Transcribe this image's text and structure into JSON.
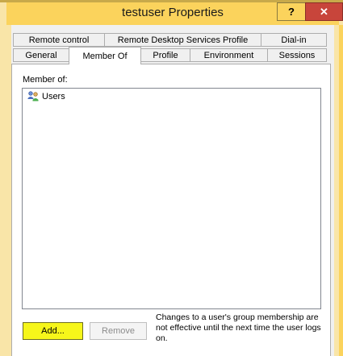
{
  "window": {
    "title": "testuser Properties",
    "help_label": "?",
    "close_label": "✕"
  },
  "tabs_row1": [
    {
      "label": "Remote control"
    },
    {
      "label": "Remote Desktop Services Profile"
    },
    {
      "label": "Dial-in"
    }
  ],
  "tabs_row2": [
    {
      "label": "General"
    },
    {
      "label": "Member Of",
      "selected": true
    },
    {
      "label": "Profile"
    },
    {
      "label": "Environment"
    },
    {
      "label": "Sessions"
    }
  ],
  "member_of": {
    "label": "Member of:",
    "items": [
      {
        "name": "Users",
        "icon": "group-icon"
      }
    ]
  },
  "buttons": {
    "add_label": "Add...",
    "remove_label": "Remove"
  },
  "note": {
    "text": "Changes to a user's group membership are not effective until the next time the user logs on."
  },
  "colors": {
    "window_frame": "#fbd35c",
    "close_button": "#c8453b",
    "add_highlight": "#f6f61a"
  }
}
